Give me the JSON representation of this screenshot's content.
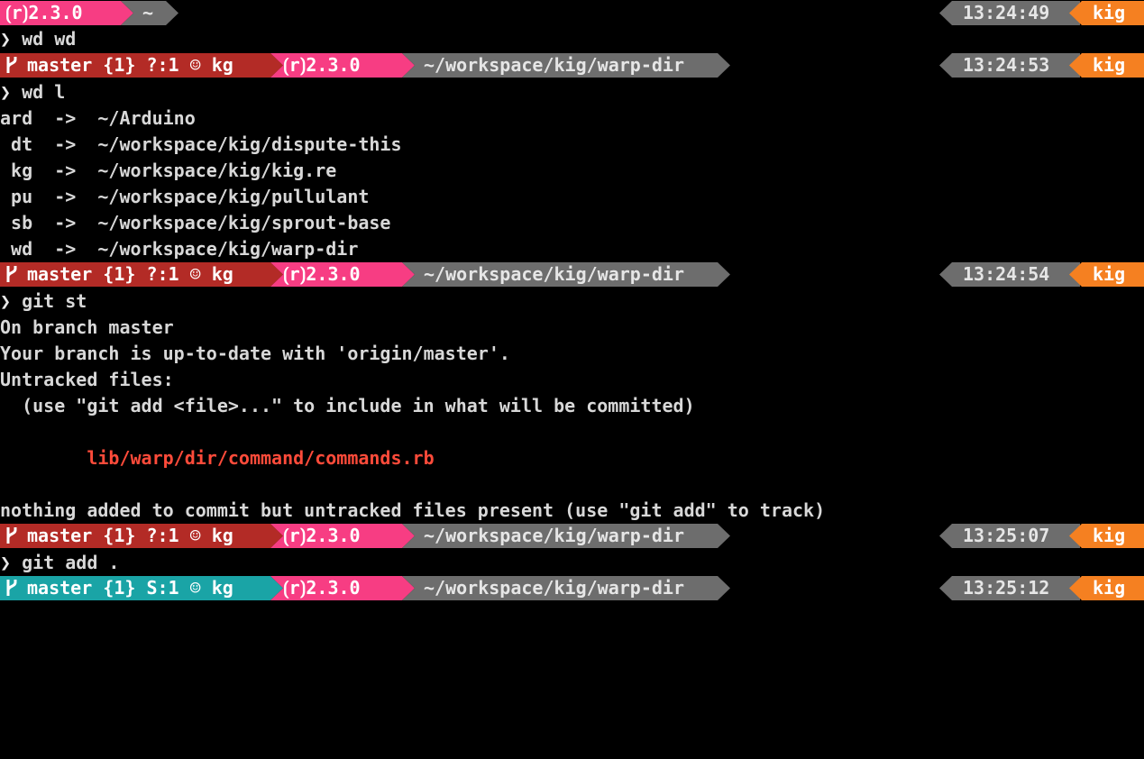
{
  "colors": {
    "git_dirty": "#b32b26",
    "git_staged": "#1aa4a6",
    "ruby": "#f73d83",
    "path": "#6d6d6d",
    "time": "#6d6d6d",
    "user": "#f58021",
    "untracked_file": "#ff4b3a",
    "background": "#000000",
    "foreground": "#d8d8d8"
  },
  "icons": {
    "branch": "git-branch-icon",
    "prompt": "chevron-right-icon"
  },
  "prompt_symbol": "❯",
  "prompts": [
    {
      "git": "",
      "ruby": "⟮r⟯2.3.0",
      "path": "~",
      "time": "13:24:49",
      "user": "kig"
    },
    {
      "git": "master {1} ?:1 ☺ kg",
      "ruby": "⟮r⟯2.3.0",
      "path": "~/workspace/kig/warp-dir",
      "time": "13:24:53",
      "user": "kig"
    },
    {
      "git": "master {1} ?:1 ☺ kg",
      "ruby": "⟮r⟯2.3.0",
      "path": "~/workspace/kig/warp-dir",
      "time": "13:24:54",
      "user": "kig"
    },
    {
      "git": "master {1} ?:1 ☺ kg",
      "ruby": "⟮r⟯2.3.0",
      "path": "~/workspace/kig/warp-dir",
      "time": "13:25:07",
      "user": "kig"
    },
    {
      "git": "master {1} S:1 ☺ kg",
      "ruby": "⟮r⟯2.3.0",
      "path": "~/workspace/kig/warp-dir",
      "time": "13:25:12",
      "user": "kig"
    }
  ],
  "commands": [
    "wd wd",
    "wd l",
    "git st",
    "git add ."
  ],
  "wd_list": [
    "ard  ->  ~/Arduino",
    " dt  ->  ~/workspace/kig/dispute-this",
    " kg  ->  ~/workspace/kig/kig.re",
    " pu  ->  ~/workspace/kig/pullulant",
    " sb  ->  ~/workspace/kig/sprout-base",
    " wd  ->  ~/workspace/kig/warp-dir"
  ],
  "git_status": {
    "line1": "On branch master",
    "line2": "Your branch is up-to-date with 'origin/master'.",
    "line3": "Untracked files:",
    "line4": "  (use \"git add <file>...\" to include in what will be committed)",
    "untracked_file": "        lib/warp/dir/command/commands.rb",
    "summary": "nothing added to commit but untracked files present (use \"git add\" to track)"
  }
}
